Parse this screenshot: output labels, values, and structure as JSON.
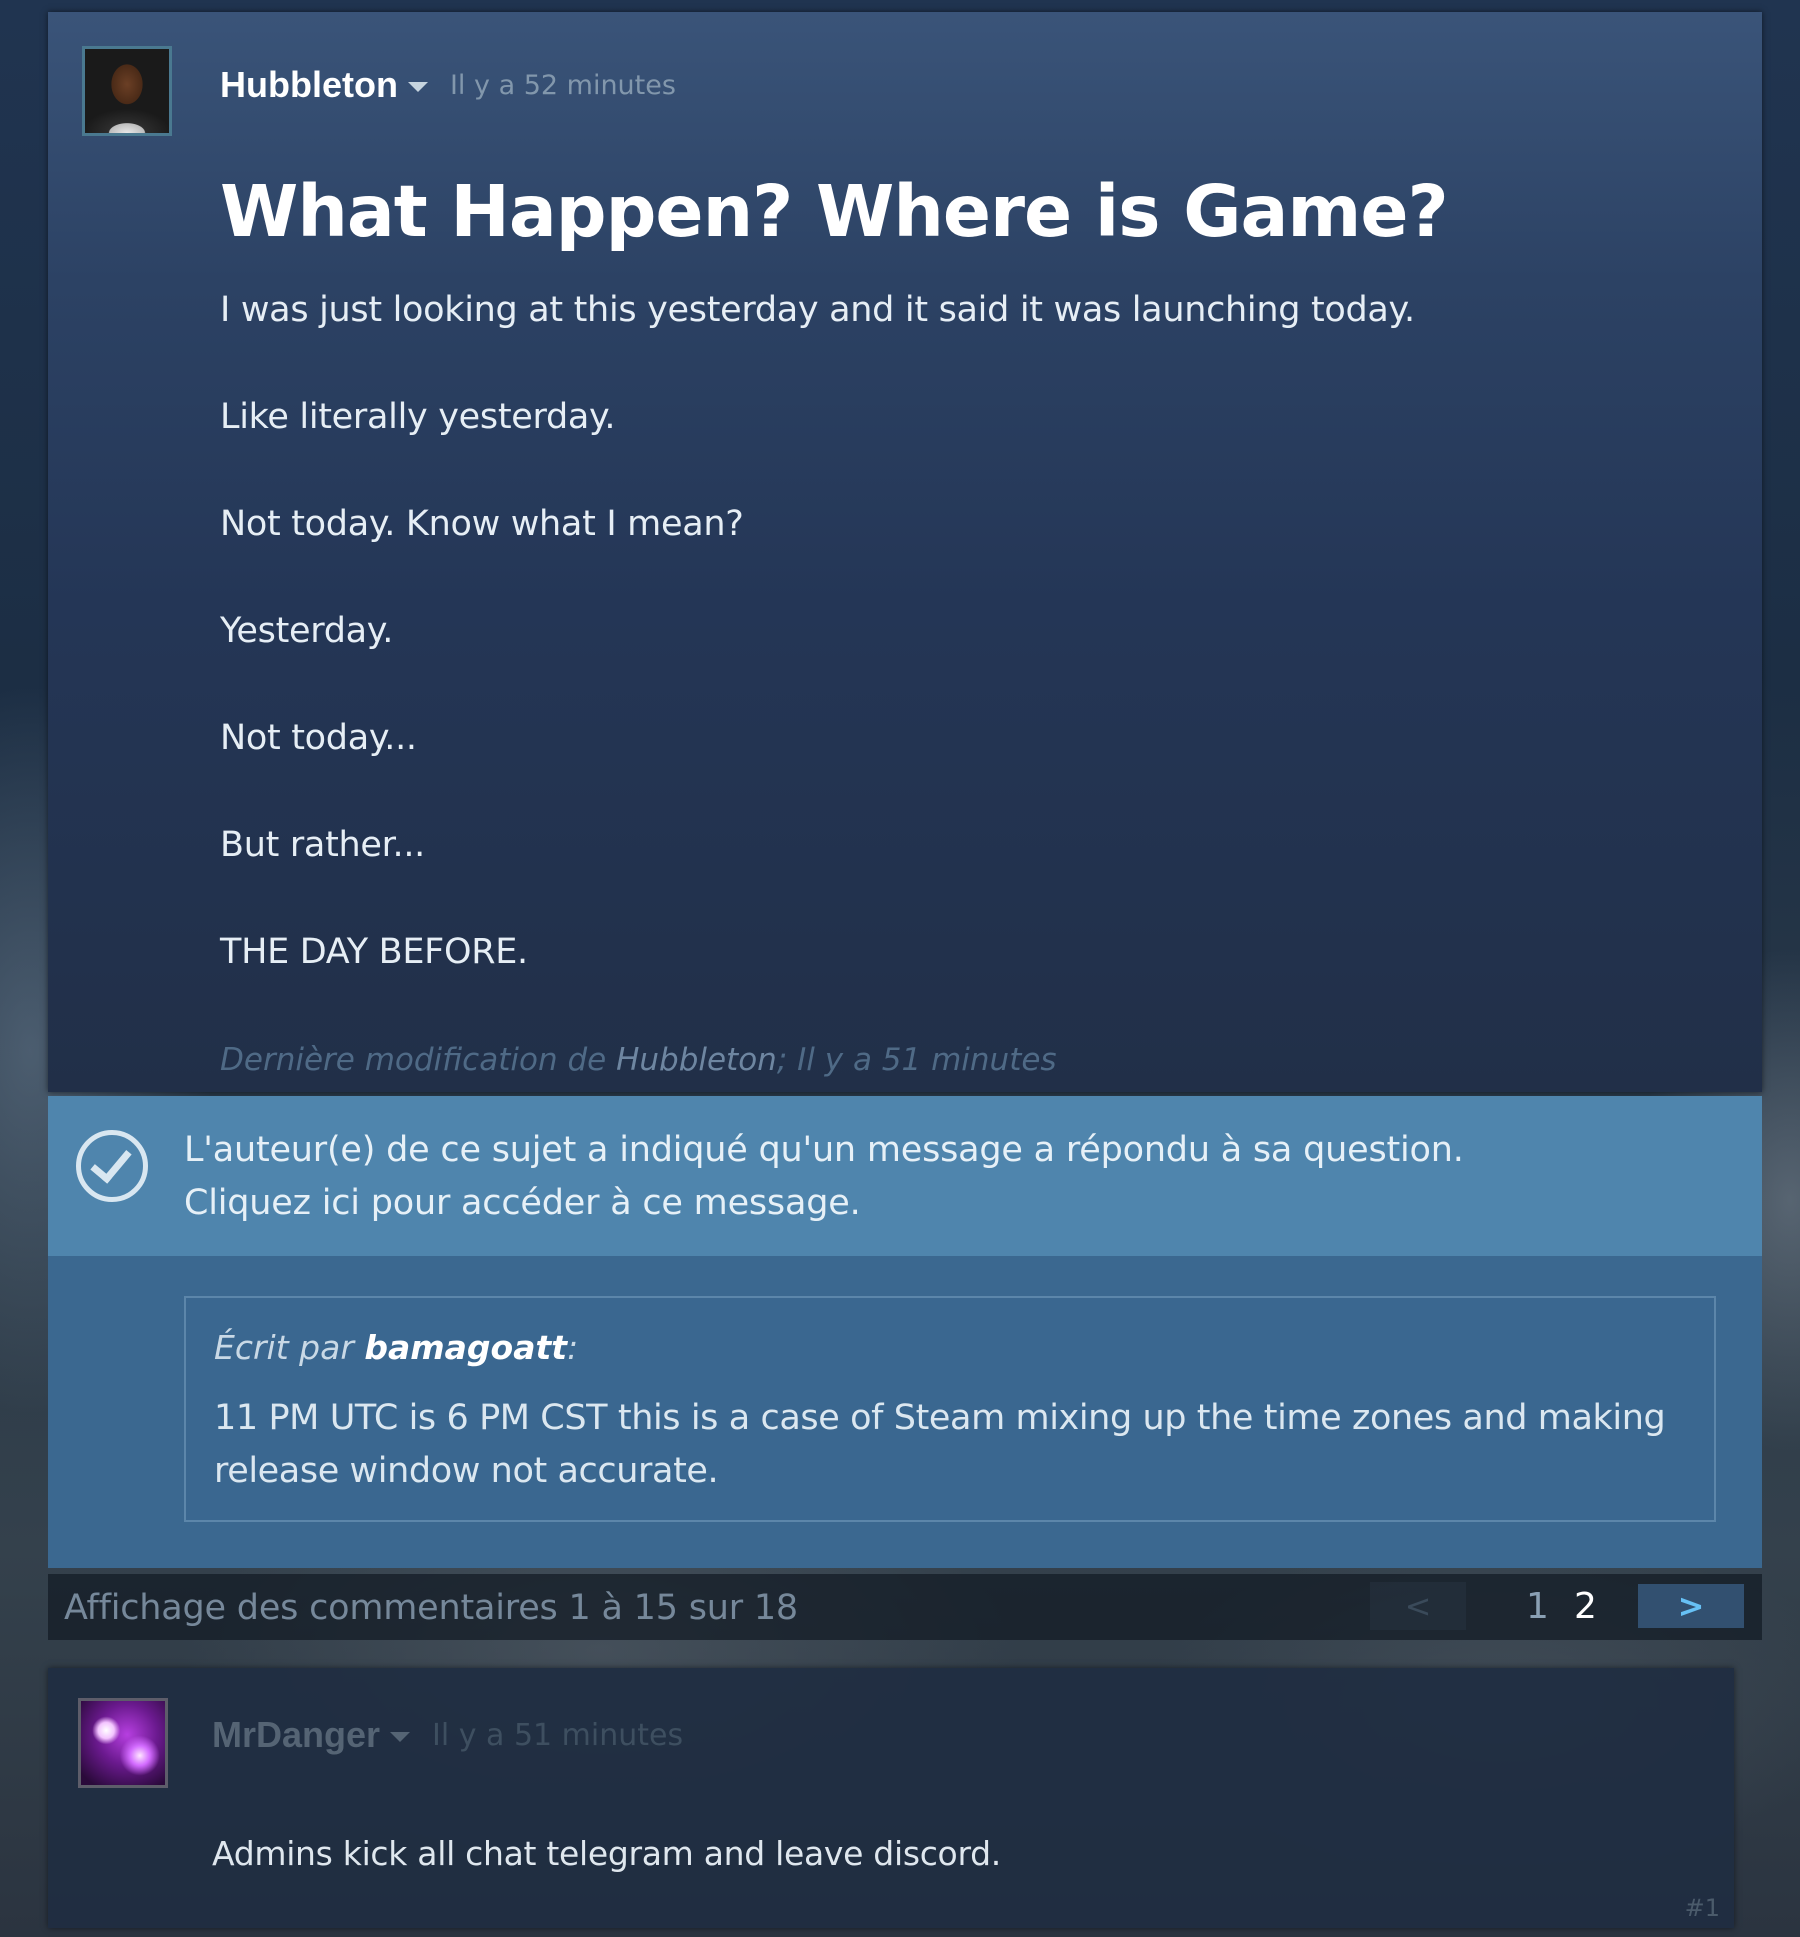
{
  "op": {
    "author": "Hubbleton",
    "timestamp": "Il y a 52 minutes",
    "title": "What Happen? Where is Game?",
    "paragraphs": [
      "I was just looking at this yesterday and it said it was launching today.",
      "Like literally yesterday.",
      "Not today. Know what I mean?",
      "Yesterday.",
      "Not today...",
      "But rather...",
      "THE DAY BEFORE."
    ],
    "edit_prefix": "Dernière modification de ",
    "edit_author": "Hubbleton",
    "edit_suffix": "; Il y a 51 minutes"
  },
  "answered": {
    "line1": "L'auteur(e) de ce sujet a indiqué qu'un message a répondu à sa question.",
    "line2": "Cliquez ici pour accéder à ce message.",
    "icon": "check-circle-icon"
  },
  "answer": {
    "written_by": "Écrit par ",
    "author": "bamagoatt",
    "colon": ":",
    "lines": [
      "11 PM UTC is 6 PM CST this is a case of Steam mixing up the time zones and making",
      "release window not accurate."
    ]
  },
  "pager": {
    "info": "Affichage des commentaires 1 à 15 sur 18",
    "prev": "<",
    "pages": [
      "1",
      "2"
    ],
    "next": ">"
  },
  "comment": {
    "author": "MrDanger",
    "timestamp": "Il y a 51 minutes",
    "body": "Admins kick all chat telegram and leave discord.",
    "number": "#1"
  },
  "colors": {
    "page_bg": "#1b2838",
    "answered_banner": "#4f85ad",
    "answer_panel": "#3b6890",
    "next_button": "#325070",
    "link_blue": "#67c1f5"
  }
}
